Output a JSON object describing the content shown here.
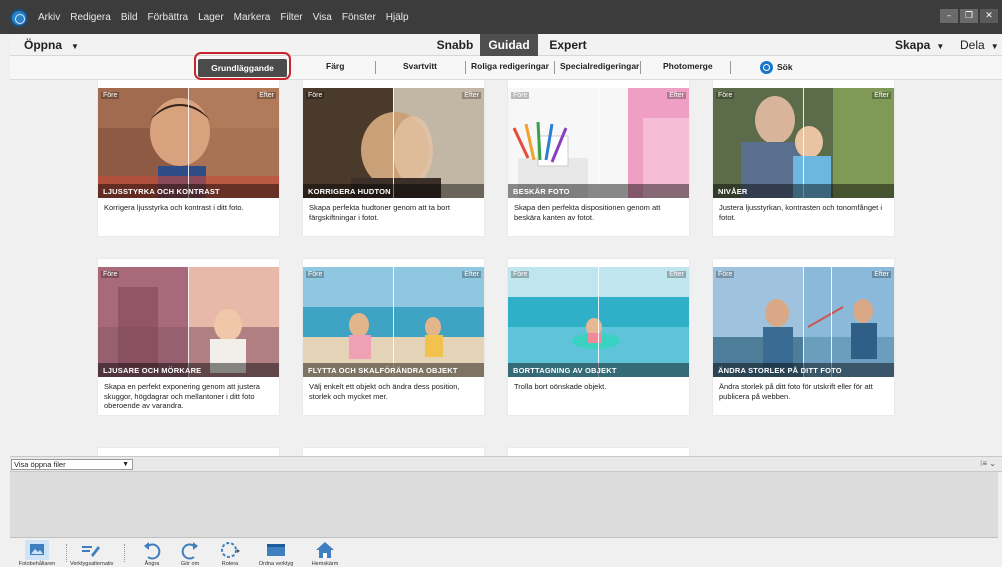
{
  "menu": {
    "items": [
      "Arkiv",
      "Redigera",
      "Bild",
      "Förbättra",
      "Lager",
      "Markera",
      "Filter",
      "Visa",
      "Fönster",
      "Hjälp"
    ]
  },
  "window_controls": {
    "minimize": "–",
    "maximize": "❐",
    "close": "✕"
  },
  "modebar": {
    "open_label": "Öppna",
    "tabs": [
      "Snabb",
      "Guidad",
      "Expert"
    ],
    "active_tab": "Guidad",
    "create_label": "Skapa",
    "share_label": "Dela"
  },
  "categories": {
    "items": [
      "Grundläggande",
      "Färg",
      "Svartvitt",
      "Roliga redigeringar",
      "Specialredigeringar",
      "Photomerge"
    ],
    "active": "Grundläggande",
    "search_label": "Sök"
  },
  "cards": [
    {
      "before": "Före",
      "after": "Efter",
      "title": "LJUSSTYRKA OCH KONTRAST",
      "desc": "Korrigera ljusstyrka och kontrast i ditt foto."
    },
    {
      "before": "Före",
      "after": "Efter",
      "title": "KORRIGERA HUDTON",
      "desc": "Skapa perfekta hudtoner genom att ta bort färgskiftningar i fotot."
    },
    {
      "before": "Före",
      "after": "Efter",
      "title": "BESKÄR FOTO",
      "desc": "Skapa den perfekta dispositionen genom att beskära kanten av fotot."
    },
    {
      "before": "Före",
      "after": "Efter",
      "title": "NIVÅER",
      "desc": "Justera ljusstyrkan, kontrasten och tonomfånget i fotot."
    },
    {
      "before": "Före",
      "after": "",
      "title": "LJUSARE OCH MÖRKARE",
      "desc": "Skapa en perfekt exponering genom att justera skuggor, högdagrar och mellantoner i ditt foto oberoende av varandra."
    },
    {
      "before": "Före",
      "after": "Efter",
      "title": "FLYTTA OCH SKALFÖRÄNDRA OBJEKT",
      "desc": "Välj enkelt ett objekt och ändra dess position, storlek och mycket mer."
    },
    {
      "before": "Före",
      "after": "Efter",
      "title": "BORTTAGNING AV OBJEKT",
      "desc": "Trolla bort oönskade objekt."
    },
    {
      "before": "Före",
      "after": "Efter",
      "title": "ÄNDRA STORLEK PÅ DITT FOTO",
      "desc": "Ändra storlek på ditt foto för utskrift eller för att publicera på webben."
    }
  ],
  "files_bar": {
    "select_label": "Visa öppna filer"
  },
  "taskbar": {
    "items": [
      "Fotobehållaren",
      "Verktygsalternativ",
      "Ångra",
      "Gör om",
      "Rotera",
      "Ordna verktyg",
      "Hemskärm"
    ]
  },
  "colors": {
    "menubar": "#3c3c3c",
    "active_tab": "#4e4e4e",
    "highlight": "#c8242d",
    "accent": "#1c76c6"
  }
}
